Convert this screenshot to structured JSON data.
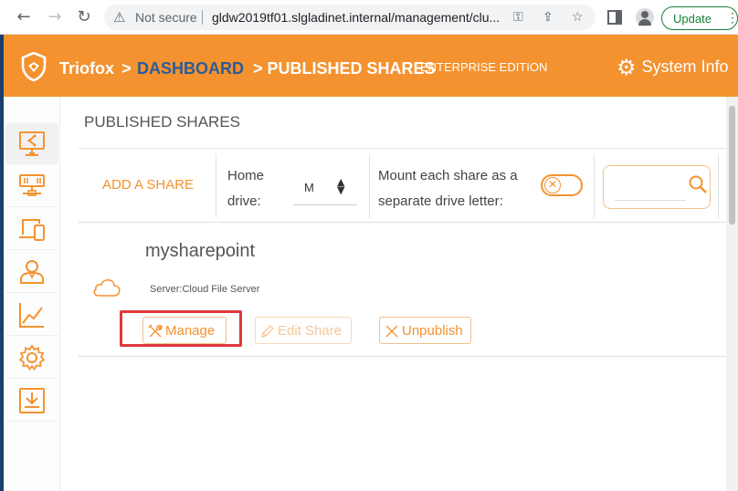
{
  "browser": {
    "security_label": "Not secure",
    "url": "gldw2019tf01.slgladinet.internal/management/clu...",
    "update_label": "Update"
  },
  "header": {
    "brand": "Triofox",
    "crumb_separator": ">",
    "crumb_dashboard": "DASHBOARD",
    "crumb_current": "> PUBLISHED SHARES",
    "edition": "ENTERPRISE EDITION",
    "system_info": "System Info"
  },
  "sidebar": {
    "items": [
      {
        "icon": "share-monitor-icon",
        "active": true
      },
      {
        "icon": "server-icon",
        "active": false
      },
      {
        "icon": "devices-icon",
        "active": false
      },
      {
        "icon": "user-icon",
        "active": false
      },
      {
        "icon": "chart-icon",
        "active": false
      },
      {
        "icon": "gear-icon",
        "active": false
      },
      {
        "icon": "download-icon",
        "active": false
      }
    ]
  },
  "main": {
    "title": "PUBLISHED SHARES",
    "toolbar": {
      "add_share": "ADD A SHARE",
      "home_drive_label": "Home drive:",
      "home_drive_value": "M",
      "mount_label": "Mount each share as a separate drive letter:",
      "mount_toggle_on": false,
      "search_placeholder": ""
    },
    "shares": [
      {
        "name": "mysharepoint",
        "server": "Server:Cloud File Server",
        "manage_label": "Manage",
        "edit_label": "Edit Share",
        "unpublish_label": "Unpublish"
      }
    ]
  },
  "colors": {
    "accent": "#f4922f",
    "crumb_link": "#2c5c98",
    "highlight": "#e0373c"
  }
}
